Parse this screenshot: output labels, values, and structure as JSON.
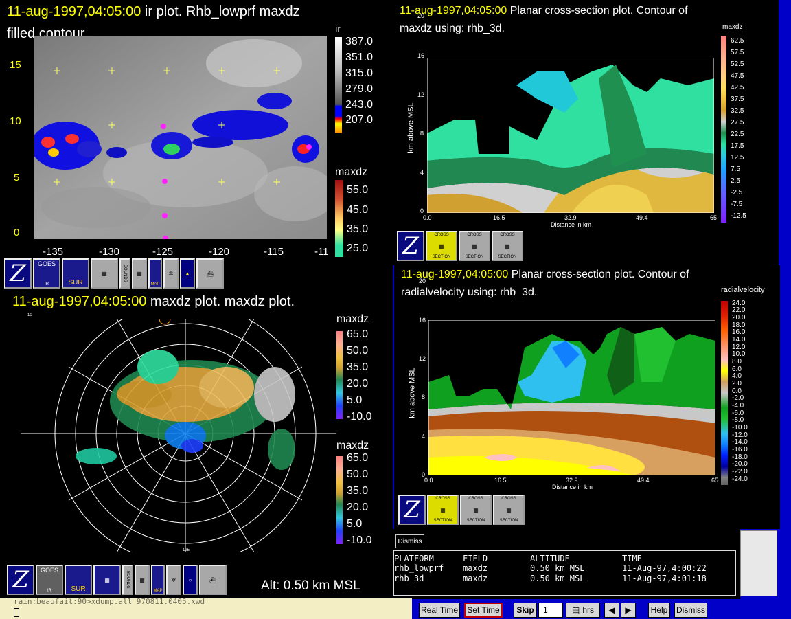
{
  "ir_window": {
    "title_time": "11-aug-1997,04:05:00",
    "title_rest": " ir plot.  Rhb_lowprf maxdz",
    "title_line2": "filled contour.",
    "ylabels": [
      "15",
      "10",
      "5",
      "0"
    ],
    "xlabels": [
      "-135",
      "-130",
      "-125",
      "-120",
      "-115",
      "-11"
    ],
    "cb1_title": "ir",
    "cb1_values": [
      "387.0",
      "351.0",
      "315.0",
      "279.0",
      "243.0",
      "207.0"
    ],
    "cb2_title": "maxdz",
    "cb2_values": [
      "55.0",
      "45.0",
      "35.0",
      "25.0"
    ]
  },
  "cross1": {
    "title_time": "11-aug-1997,04:05:00",
    "title_rest": " Planar cross-section plot.  Contour of",
    "title_line2": "maxdz using: rhb_3d.",
    "cb_title": "maxdz",
    "cb_values": [
      "62.5",
      "57.5",
      "52.5",
      "47.5",
      "42.5",
      "37.5",
      "32.5",
      "27.5",
      "22.5",
      "17.5",
      "12.5",
      "7.5",
      "2.5",
      "-2.5",
      "-7.5",
      "-12.5"
    ],
    "yticks": [
      "20",
      "16",
      "12",
      "8",
      "4",
      "0"
    ],
    "xticks": [
      "0.0",
      "16.5",
      "32.9",
      "49.4",
      "65"
    ],
    "ylabel": "km above MSL",
    "xlabel": "Distance in km"
  },
  "cross2": {
    "title_time": "11-aug-1997,04:05:00",
    "title_rest": " Planar cross-section plot.  Contour of",
    "title_line2": "radialvelocity using: rhb_3d.",
    "cb_title": "radialvelocity",
    "cb_values": [
      "24.0",
      "22.0",
      "20.0",
      "18.0",
      "16.0",
      "14.0",
      "12.0",
      "10.0",
      "8.0",
      "6.0",
      "4.0",
      "2.0",
      "0.0",
      "-2.0",
      "-4.0",
      "-6.0",
      "-8.0",
      "-10.0",
      "-12.0",
      "-14.0",
      "-16.0",
      "-18.0",
      "-20.0",
      "-22.0",
      "-24.0"
    ],
    "yticks": [
      "20",
      "16",
      "12",
      "8",
      "4",
      "0"
    ],
    "xticks": [
      "0.0",
      "16.5",
      "32.9",
      "49.4",
      "65"
    ],
    "ylabel": "km above MSL",
    "xlabel": "Distance in km"
  },
  "radar_window": {
    "title_time": "11-aug-1997,04:05:00",
    "title_rest": " maxdz plot.  maxdz plot.",
    "cb_title": "maxdz",
    "cb_values": [
      "65.0",
      "50.0",
      "35.0",
      "20.0",
      "5.0",
      "-10.0"
    ],
    "cb2_title": "maxdz",
    "cb2_values": [
      "65.0",
      "50.0",
      "35.0",
      "20.0",
      "5.0",
      "-10.0"
    ],
    "alt_text": "Alt: 0.50 km MSL",
    "small_top": "10",
    "small_bottom": "-125"
  },
  "toolbar": {
    "goes": "GOES",
    "ir": "IR",
    "sur": "SUR",
    "bounds": "BOUNDS",
    "map": "MAP",
    "cross": "CROSS",
    "section": "SECTION"
  },
  "info_panel": {
    "dismiss": "Dismiss",
    "headers": [
      "PLATFORM",
      "FIELD",
      "ALTITUDE",
      "TIME"
    ],
    "rows": [
      [
        "rhb_lowprf",
        "maxdz",
        "0.50 km MSL",
        "11-Aug-97,4:00:22"
      ],
      [
        "rhb_3d",
        "maxdz",
        "0.50 km MSL",
        "11-Aug-97,4:01:18"
      ]
    ]
  },
  "terminal": {
    "line": "rain:beaufait:90>xdump.all 970811.0405.xwd"
  },
  "bottom_bar": {
    "real_time": "Real Time",
    "set_time": "Set Time",
    "skip": "Skip",
    "skip_value": "1",
    "hrs": "hrs",
    "help": "Help",
    "dismiss": "Dismiss"
  }
}
